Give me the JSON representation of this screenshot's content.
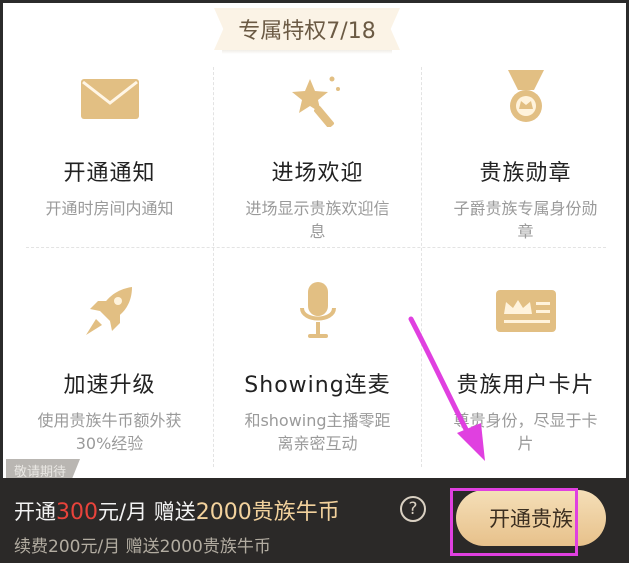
{
  "header": {
    "title": "专属特权7/18"
  },
  "privileges": [
    {
      "title": "开通通知",
      "desc": "开通时房间内通知",
      "icon": "envelope-icon"
    },
    {
      "title": "进场欢迎",
      "desc": "进场显示贵族欢迎信息",
      "icon": "magic-wand-icon"
    },
    {
      "title": "贵族勋章",
      "desc": "子爵贵族专属身份勋章",
      "icon": "medal-icon"
    },
    {
      "title": "加速升级",
      "desc": "使用贵族牛币额外获30%经验",
      "icon": "rocket-icon"
    },
    {
      "title": "Showing连麦",
      "desc": "和showing主播零距离亲密互动",
      "icon": "microphone-icon"
    },
    {
      "title": "贵族用户卡片",
      "desc": "尊贵身份，尽显于卡片",
      "icon": "id-card-icon"
    }
  ],
  "coming_soon": "敬请期待",
  "footer": {
    "price_prefix": "开通",
    "price_amount": "300",
    "price_unit": "元/月 赠送",
    "gift_amount": "2000",
    "gift_unit": "贵族牛币",
    "renew": "续费200元/月 赠送2000贵族牛币",
    "help_label": "?",
    "button_label": "开通贵族"
  },
  "colors": {
    "gold": "#e2bf83",
    "highlight": "#e040e0",
    "price_red": "#e8433b",
    "footer_bg": "#2b2928"
  }
}
